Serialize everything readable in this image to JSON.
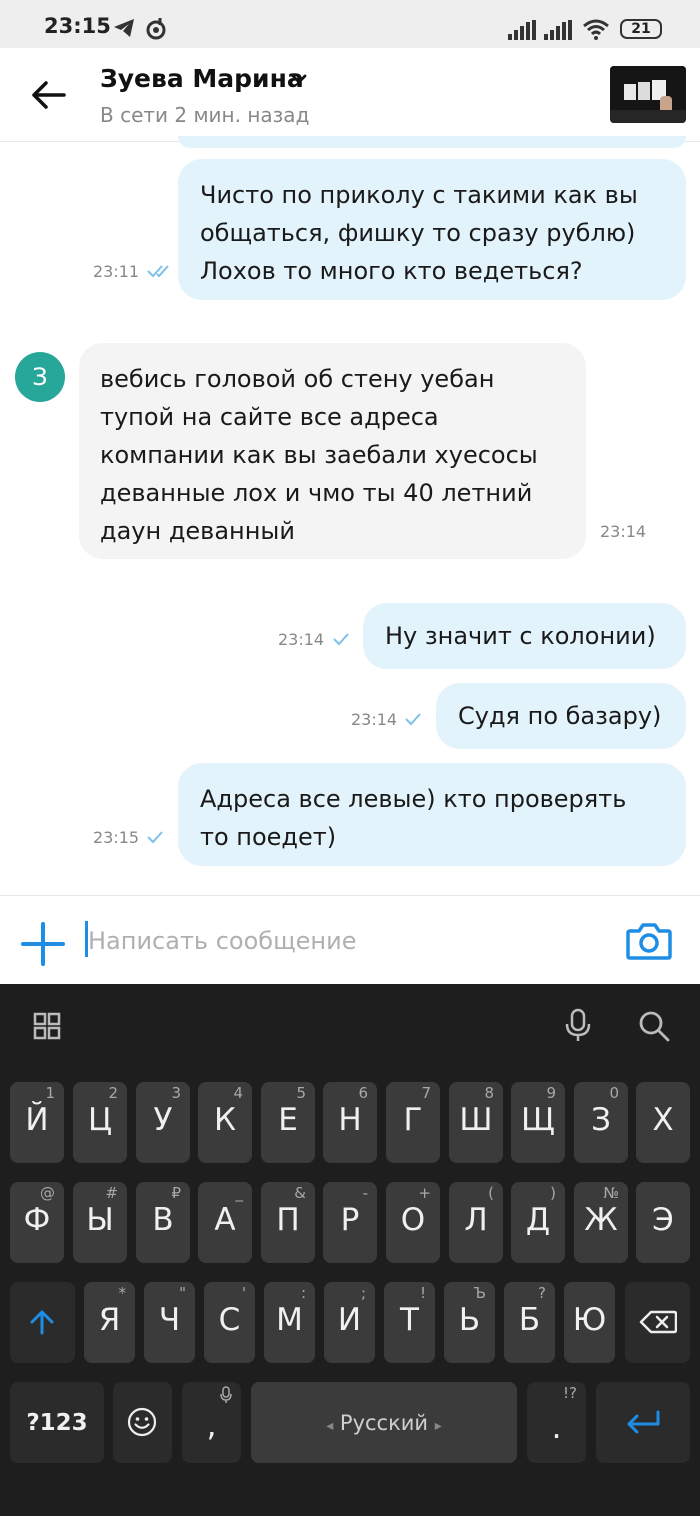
{
  "status_bar": {
    "time": "23:15",
    "battery": "21",
    "icons": [
      "telegram-icon",
      "music-icon",
      "signal-icon",
      "signal-icon",
      "wifi-icon",
      "battery-icon"
    ]
  },
  "header": {
    "contact_name": "Зуева Марина",
    "presence": "В сети 2 мин. назад"
  },
  "messages": [
    {
      "direction": "out",
      "lines": [
        "Чисто по приколу с такими как вы",
        "общаться, фишку то сразу рублю)",
        "Лохов то много кто ведеться?"
      ],
      "time": "23:11",
      "status": "read"
    },
    {
      "direction": "in",
      "avatar_letter": "З",
      "lines": [
        "вебись головой об стену уебан",
        "тупой на сайте все адреса",
        "компании как вы заебали хуесосы",
        "деванные лох и чмо ты 40 летний",
        "даун деванный"
      ],
      "time": "23:14"
    },
    {
      "direction": "out",
      "lines": [
        "Ну значит с колонии)"
      ],
      "time": "23:14",
      "status": "delivered"
    },
    {
      "direction": "out",
      "lines": [
        "Судя по базару)"
      ],
      "time": "23:14",
      "status": "delivered"
    },
    {
      "direction": "out",
      "lines": [
        "Адреса все левые) кто проверять",
        "то поедет)"
      ],
      "time": "23:15",
      "status": "delivered"
    }
  ],
  "composer": {
    "placeholder": "Написать сообщение"
  },
  "keyboard": {
    "row1": [
      [
        "Й",
        "1"
      ],
      [
        "Ц",
        "2"
      ],
      [
        "У",
        "3"
      ],
      [
        "К",
        "4"
      ],
      [
        "Е",
        "5"
      ],
      [
        "Н",
        "6"
      ],
      [
        "Г",
        "7"
      ],
      [
        "Ш",
        "8"
      ],
      [
        "Щ",
        "9"
      ],
      [
        "З",
        "0"
      ],
      [
        "Х",
        ""
      ]
    ],
    "row2": [
      [
        "Ф",
        "@"
      ],
      [
        "Ы",
        "#"
      ],
      [
        "В",
        "₽"
      ],
      [
        "А",
        "_"
      ],
      [
        "П",
        "&"
      ],
      [
        "Р",
        "-"
      ],
      [
        "О",
        "+"
      ],
      [
        "Л",
        "("
      ],
      [
        "Д",
        ")"
      ],
      [
        "Ж",
        "№"
      ],
      [
        "Э",
        ""
      ]
    ],
    "row3": [
      [
        "Я",
        "*"
      ],
      [
        "Ч",
        "\""
      ],
      [
        "С",
        "'"
      ],
      [
        "М",
        ":"
      ],
      [
        "И",
        ";"
      ],
      [
        "Т",
        "!"
      ],
      [
        "Ь",
        "Ъ"
      ],
      [
        "Б",
        "?"
      ],
      [
        "Ю",
        ""
      ]
    ],
    "symbols_label": "?123",
    "comma": ",",
    "space_label": "Русский",
    "period": ".",
    "period_hint": "!?"
  },
  "colors": {
    "accent": "#1d8de5",
    "outgoing_bubble": "#e3f3fc",
    "incoming_bubble": "#f4f4f4",
    "avatar": "#27a69a",
    "keyboard_bg": "#1e1e1e",
    "key_bg": "#3b3b3b"
  }
}
